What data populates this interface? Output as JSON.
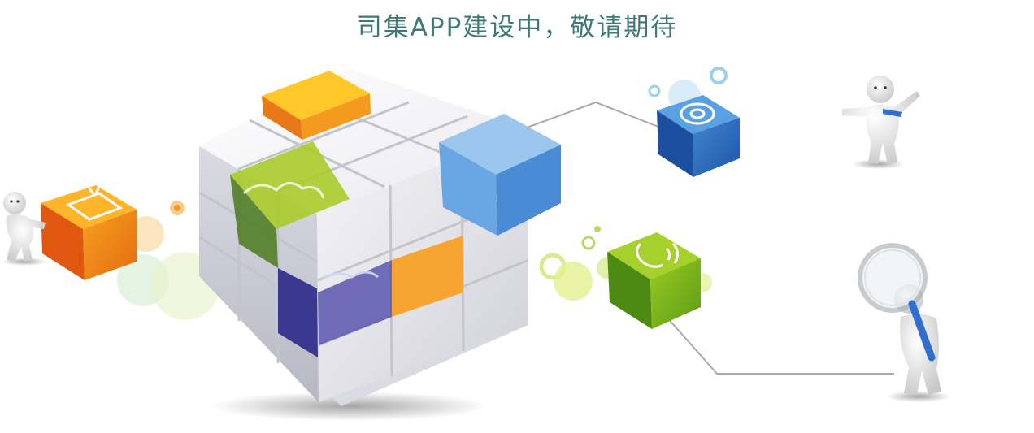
{
  "page": {
    "headline": "司集APP建设中，敬请期待"
  },
  "colors": {
    "headline": "#3c7a76",
    "orange": "#f0901a",
    "green": "#8cbd1a",
    "blue": "#3f86cf",
    "purple": "#3a3890",
    "connector": "#a9a9a9"
  },
  "icons": {
    "tv": "tv-icon",
    "email": "at-sign-icon",
    "phone": "phone-icon",
    "magnifier": "magnifying-glass-icon"
  }
}
